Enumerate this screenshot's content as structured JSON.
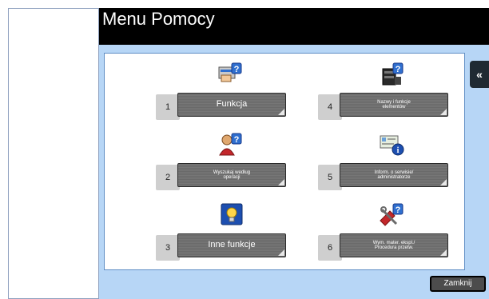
{
  "window": {
    "title": "Menu Pomocy"
  },
  "nav": {
    "back_glyph": "«"
  },
  "items": [
    {
      "number": "1",
      "label": "Funkcja",
      "icon": "function-icon"
    },
    {
      "number": "2",
      "label": "Wyszukaj według\noperacji",
      "icon": "person-question-icon"
    },
    {
      "number": "3",
      "label": "Inne funkcje",
      "icon": "lightbulb-icon"
    },
    {
      "number": "4",
      "label": "Nazwy i funkcje\nelementów",
      "icon": "printer-question-icon"
    },
    {
      "number": "5",
      "label": "Inform. o serwisie/\nadministratorze",
      "icon": "info-card-icon"
    },
    {
      "number": "6",
      "label": "Wym. mater. ekspl./\nProcedura przetw.",
      "icon": "tools-question-icon"
    }
  ],
  "footer": {
    "close_label": "Zamknij"
  },
  "colors": {
    "accent": "#1a4fbf",
    "panel_bg": "#b7d6f6",
    "title_bg": "#000000"
  }
}
